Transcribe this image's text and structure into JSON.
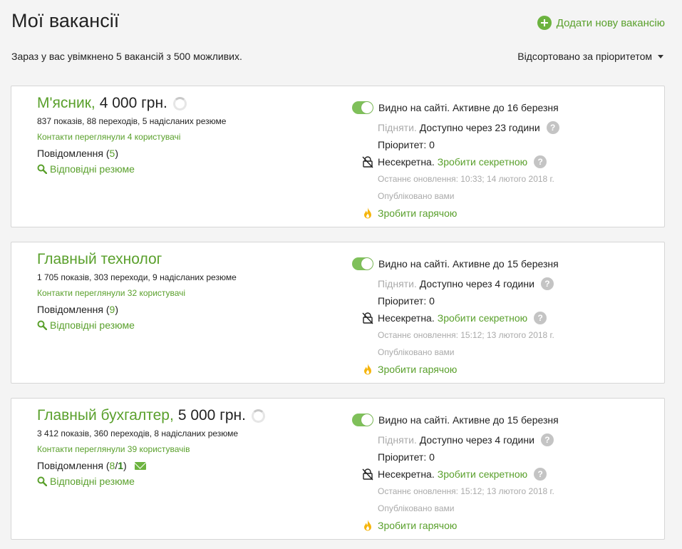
{
  "header": {
    "title": "Мої вакансії",
    "add_label": "Додати нову вакансію",
    "summary": "Зараз у вас увімкнено 5 вакансій з 500 можливих.",
    "sort_label": "Відсортовано за пріоритетом"
  },
  "icons": {
    "add": "plus-circle-icon",
    "sort": "caret-down-icon",
    "search": "search-icon",
    "help": "question-circle-icon",
    "unlocked": "lock-crossed-icon",
    "hot": "fire-icon",
    "loading": "spinner-icon",
    "envelope": "envelope-icon"
  },
  "colors": {
    "accent": "#5aa02c",
    "toggle": "#7fc05a",
    "fire": "#f5b50d",
    "muted": "#aaaaaa"
  },
  "labels": {
    "messages": "Повідомлення",
    "resumes": "Відповідні резюме",
    "lift": "Підняти.",
    "non_secret": "Несекретна.",
    "make_secret": "Зробити секретною",
    "published_by": "Опубліковано вами",
    "make_hot": "Зробити гарячою",
    "help_glyph": "?"
  },
  "vacancies": [
    {
      "name": "М'ясник,",
      "salary": "4 000 грн.",
      "stats": "837 показів, 88 переходів, 5 надісланих резюме",
      "contacts": "Контакти переглянули 4 користувачі",
      "messages_open": "(",
      "messages_count": "5",
      "messages_close": ")",
      "visibility": "Видно на сайті. Активне до 16 березня",
      "available_in": "Доступно через 23 години",
      "priority": "Пріоритет: 0",
      "last_update": "Останнє оновлення: 10:33; 14 лютого 2018 г."
    },
    {
      "name": "Главный технолог",
      "salary": "",
      "stats": "1 705 показів, 303 переходи, 9 надісланих резюме",
      "contacts": "Контакти переглянули 32 користувачі",
      "messages_open": "(",
      "messages_count": "9",
      "messages_close": ")",
      "visibility": "Видно на сайті. Активне до 15 березня",
      "available_in": "Доступно через 4 години",
      "priority": "Пріоритет: 0",
      "last_update": "Останнє оновлення: 15:12; 13 лютого 2018 г."
    },
    {
      "name": "Главный бухгалтер,",
      "salary": "5 000 грн.",
      "stats": "3 412 показів, 360 переходів, 8 надісланих резюме",
      "contacts": "Контакти переглянули 39 користувачів",
      "messages_open": "(",
      "messages_count": "8",
      "messages_sep": " / ",
      "messages_new": "1",
      "messages_close": ")",
      "visibility": "Видно на сайті. Активне до 15 березня",
      "available_in": "Доступно через 4 години",
      "priority": "Пріоритет: 0",
      "last_update": "Останнє оновлення: 15:12; 13 лютого 2018 г."
    }
  ]
}
